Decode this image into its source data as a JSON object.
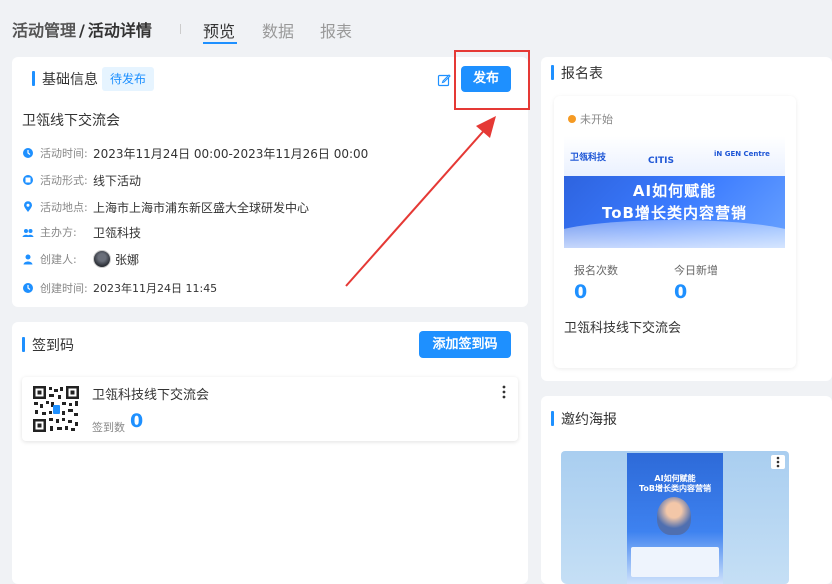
{
  "header": {
    "breadcrumb": [
      "活动管理",
      "活动详情"
    ],
    "breadcrumb_sep": "/",
    "tabs": [
      "预览",
      "数据",
      "报表"
    ],
    "active_tab": "预览"
  },
  "basic_info": {
    "title": "基础信息",
    "status_badge": "待发布",
    "publish_label": "发布",
    "event_name": "卫瓴线下交流会",
    "rows": [
      {
        "label": "活动时间:",
        "value": "2023年11月24日 00:00-2023年11月26日 00:00",
        "icon": "clock-icon"
      },
      {
        "label": "活动形式:",
        "value": "线下活动",
        "icon": "format-icon"
      },
      {
        "label": "活动地点:",
        "value": "上海市上海市浦东新区盛大全球研发中心",
        "icon": "location-pin-icon"
      },
      {
        "label": "主办方:",
        "value": "卫瓴科技",
        "icon": "group-icon"
      },
      {
        "label": "创建人:",
        "value": "张娜",
        "icon": "user-icon"
      },
      {
        "label": "创建时间:",
        "value": "2023年11月24日 11:45",
        "icon": "clock-icon"
      }
    ]
  },
  "checkin": {
    "title": "签到码",
    "add_label": "添加签到码",
    "items": [
      {
        "name": "卫瓴科技线下交流会",
        "count_label": "签到数",
        "count": "0"
      }
    ]
  },
  "registration": {
    "title": "报名表",
    "status": "未开始",
    "banner": {
      "logo1": "卫瓴科技",
      "logo2": "CITIS",
      "logo3": "iN GEN Centre",
      "headline1": "AI如何赋能",
      "headline2": "ToB增长类内容营销"
    },
    "stats": [
      {
        "label": "报名次数",
        "value": "0"
      },
      {
        "label": "今日新增",
        "value": "0"
      }
    ],
    "form_name": "卫瓴科技线下交流会"
  },
  "poster": {
    "title": "邀约海报",
    "headline1": "AI如何赋能",
    "headline2": "ToB增长类内容营销"
  },
  "colors": {
    "accent": "#1e90ff",
    "highlight": "#e53935",
    "status_dot": "#f59a23"
  }
}
